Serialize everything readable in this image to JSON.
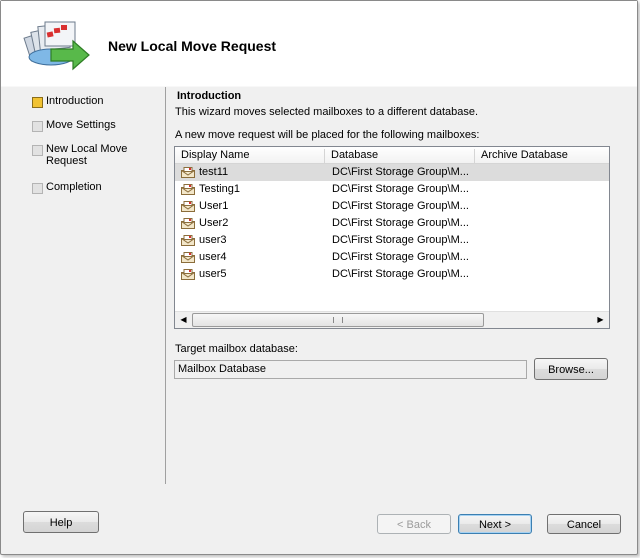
{
  "window": {
    "title": "New Local Move Request"
  },
  "sidebar": {
    "steps": [
      {
        "label": "Introduction",
        "active": true
      },
      {
        "label": "Move Settings",
        "active": false
      },
      {
        "label": "New Local Move Request",
        "active": false
      },
      {
        "label": "Completion",
        "active": false
      }
    ]
  },
  "main": {
    "section_title": "Introduction",
    "description": "This wizard moves selected mailboxes to a different database.",
    "list_caption": "A new move request will be placed for the following mailboxes:",
    "columns": [
      "Display Name",
      "Database",
      "Archive Database"
    ],
    "rows": [
      {
        "name": "test11",
        "database": "DC\\First Storage Group\\M...",
        "archive": "",
        "selected": true
      },
      {
        "name": "Testing1",
        "database": "DC\\First Storage Group\\M...",
        "archive": "",
        "selected": false
      },
      {
        "name": "User1",
        "database": "DC\\First Storage Group\\M...",
        "archive": "",
        "selected": false
      },
      {
        "name": "User2",
        "database": "DC\\First Storage Group\\M...",
        "archive": "",
        "selected": false
      },
      {
        "name": "user3",
        "database": "DC\\First Storage Group\\M...",
        "archive": "",
        "selected": false
      },
      {
        "name": "user4",
        "database": "DC\\First Storage Group\\M...",
        "archive": "",
        "selected": false
      },
      {
        "name": "user5",
        "database": "DC\\First Storage Group\\M...",
        "archive": "",
        "selected": false
      }
    ],
    "target_label": "Target mailbox database:",
    "target_value": "Mailbox Database",
    "browse_label": "Browse..."
  },
  "footer": {
    "help_label": "Help",
    "back_label": "< Back",
    "next_label": "Next >",
    "cancel_label": "Cancel"
  },
  "colors": {
    "active_step": "#f1c232",
    "selected_row": "#dcdcdc",
    "default_button_border": "#3c7fb1"
  }
}
